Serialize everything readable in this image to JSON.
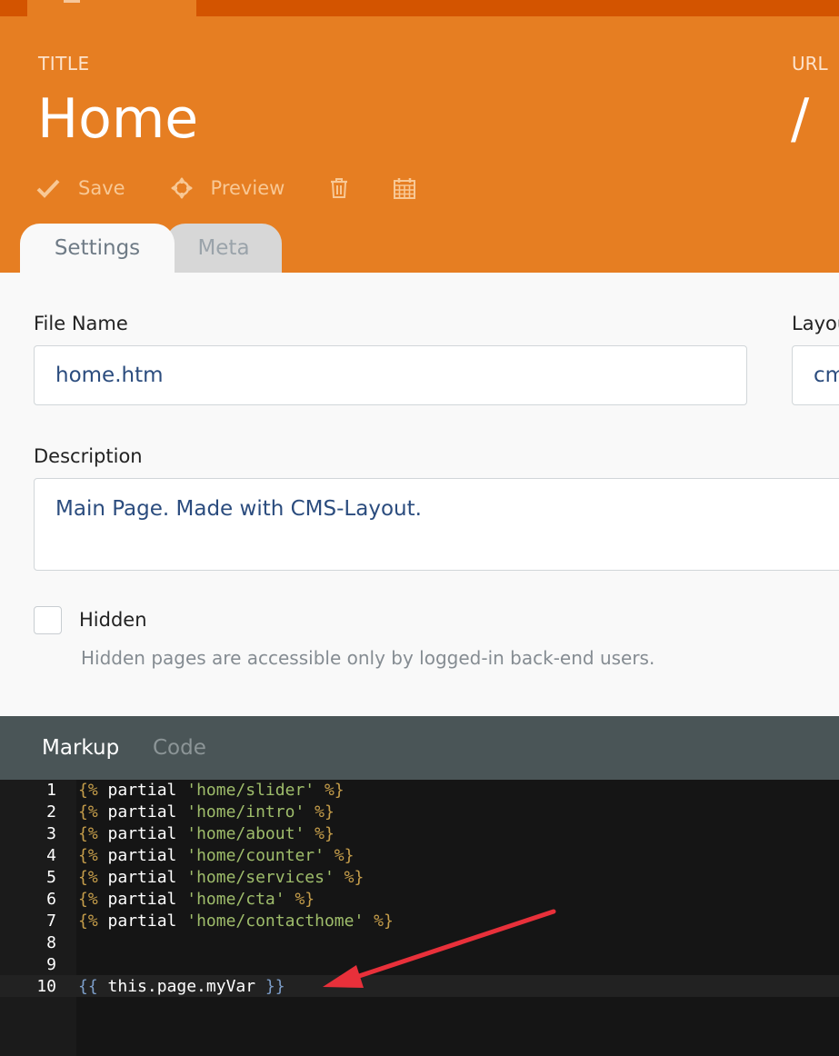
{
  "header": {
    "title_label": "TITLE",
    "title_value": "Home",
    "url_label": "URL",
    "url_value": "/"
  },
  "toolbar": {
    "save_label": "Save",
    "preview_label": "Preview",
    "save_icon": "check-icon",
    "preview_icon": "crosshair-icon",
    "delete_icon": "trash-icon",
    "schedule_icon": "calendar-icon"
  },
  "tabs": [
    {
      "label": "Settings",
      "active": true
    },
    {
      "label": "Meta",
      "active": false
    }
  ],
  "form": {
    "file_name_label": "File Name",
    "file_name_value": "home.htm",
    "layout_label": "Layou",
    "layout_value": "cm",
    "description_label": "Description",
    "description_value": "Main Page. Made with CMS-Layout.",
    "hidden_label": "Hidden",
    "hidden_checked": false,
    "hidden_help": "Hidden pages are accessible only by logged-in back-end users."
  },
  "editor": {
    "tabs": [
      {
        "label": "Markup",
        "active": true
      },
      {
        "label": "Code",
        "active": false
      }
    ],
    "lines": [
      {
        "n": "1",
        "open": "{%",
        "kw": " partial ",
        "str": "'home/slider'",
        "close": " %}"
      },
      {
        "n": "2",
        "open": "{%",
        "kw": " partial ",
        "str": "'home/intro'",
        "close": " %}"
      },
      {
        "n": "3",
        "open": "{%",
        "kw": " partial ",
        "str": "'home/about'",
        "close": " %}"
      },
      {
        "n": "4",
        "open": "{%",
        "kw": " partial ",
        "str": "'home/counter'",
        "close": " %}"
      },
      {
        "n": "5",
        "open": "{%",
        "kw": " partial ",
        "str": "'home/services'",
        "close": " %}"
      },
      {
        "n": "6",
        "open": "{%",
        "kw": " partial ",
        "str": "'home/cta'",
        "close": " %}"
      },
      {
        "n": "7",
        "open": "{%",
        "kw": " partial ",
        "str": "'home/contacthome'",
        "close": " %}"
      },
      {
        "n": "8",
        "open": "",
        "kw": "",
        "str": "",
        "close": ""
      },
      {
        "n": "9",
        "open": "",
        "kw": "",
        "str": "",
        "close": ""
      },
      {
        "n": "10",
        "open": "{{",
        "kw": " this.page.myVar ",
        "str": "",
        "close": "}}"
      }
    ],
    "active_line": "10"
  },
  "colors": {
    "header_orange": "#e67e22",
    "topbar_orange": "#d35400",
    "arrow_red": "#e8303a"
  }
}
